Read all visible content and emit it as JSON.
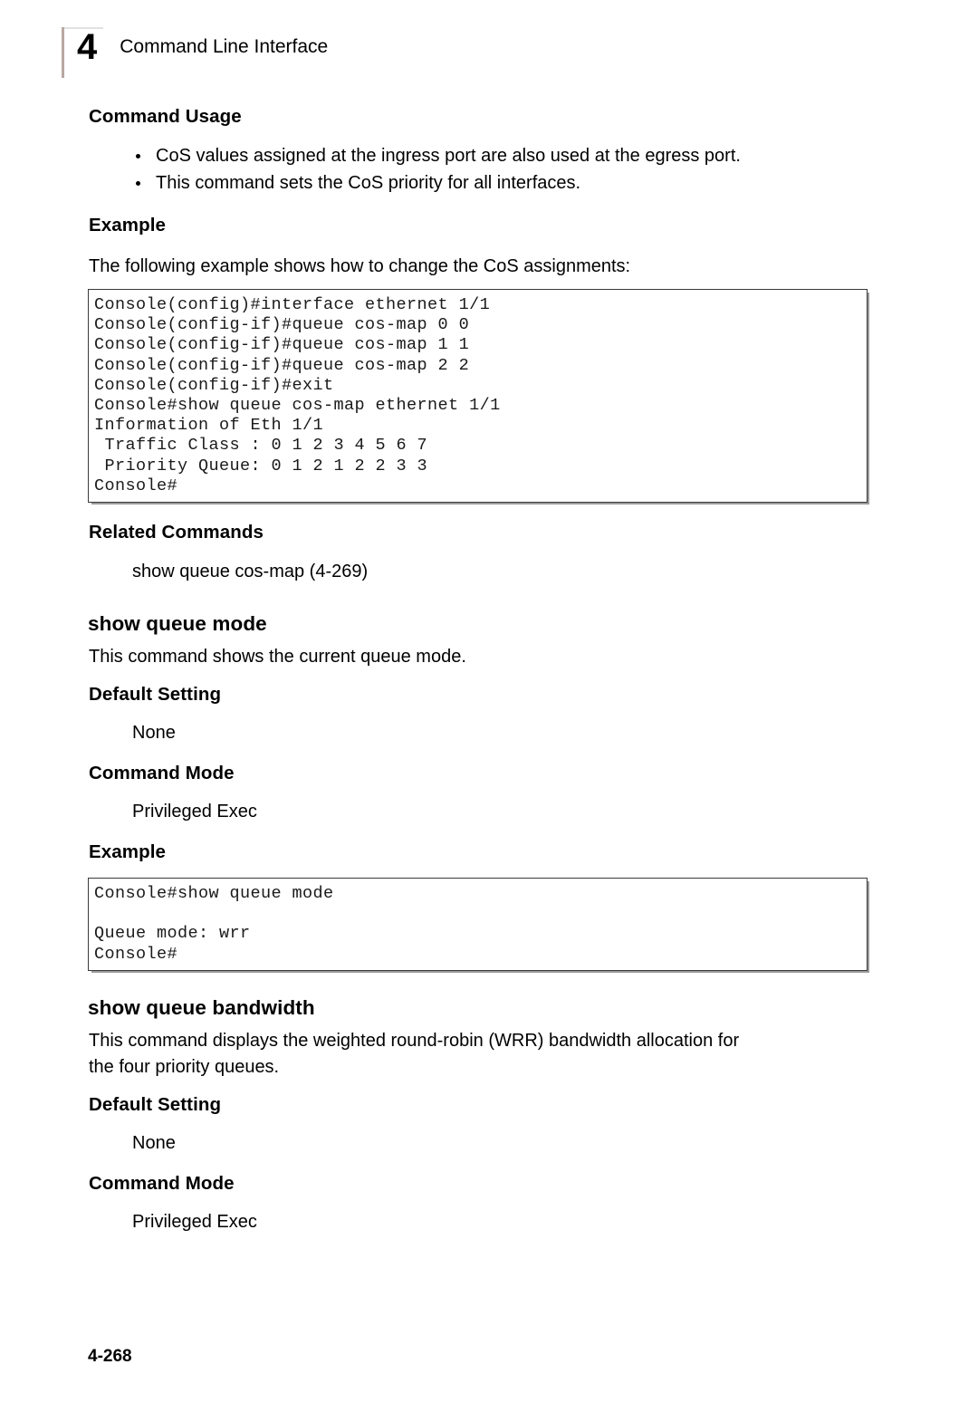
{
  "header": {
    "chapter_number": "4",
    "title": "Command Line Interface"
  },
  "sections": {
    "command_usage": {
      "heading": "Command Usage",
      "bullets": [
        "CoS values assigned at the ingress port are also used at the egress port.",
        "This command sets the CoS priority for all interfaces."
      ]
    },
    "example_1": {
      "heading": "Example",
      "intro": "The following example shows how to change the CoS assignments:",
      "code": "Console(config)#interface ethernet 1/1\nConsole(config-if)#queue cos-map 0 0\nConsole(config-if)#queue cos-map 1 1\nConsole(config-if)#queue cos-map 2 2\nConsole(config-if)#exit\nConsole#show queue cos-map ethernet 1/1\nInformation of Eth 1/1\n Traffic Class : 0 1 2 3 4 5 6 7\n Priority Queue: 0 1 2 1 2 2 3 3\nConsole#"
    },
    "related_commands": {
      "heading": "Related Commands",
      "items": [
        "show queue cos-map (4-269)"
      ]
    },
    "show_queue_mode": {
      "command": "show queue mode",
      "description": "This command shows the current queue mode.",
      "default_setting_heading": "Default Setting",
      "default_setting_value": "None",
      "command_mode_heading": "Command Mode",
      "command_mode_value": "Privileged Exec",
      "example_heading": "Example",
      "code": "Console#show queue mode\n\nQueue mode: wrr\nConsole#"
    },
    "show_queue_bandwidth": {
      "command": "show queue bandwidth",
      "description_line_1": "This command displays the weighted round-robin (WRR) bandwidth allocation for",
      "description_line_2": "the four priority queues.",
      "default_setting_heading": "Default Setting",
      "default_setting_value": "None",
      "command_mode_heading": "Command Mode",
      "command_mode_value": "Privileged Exec"
    }
  },
  "footer": {
    "page_number": "4-268"
  }
}
